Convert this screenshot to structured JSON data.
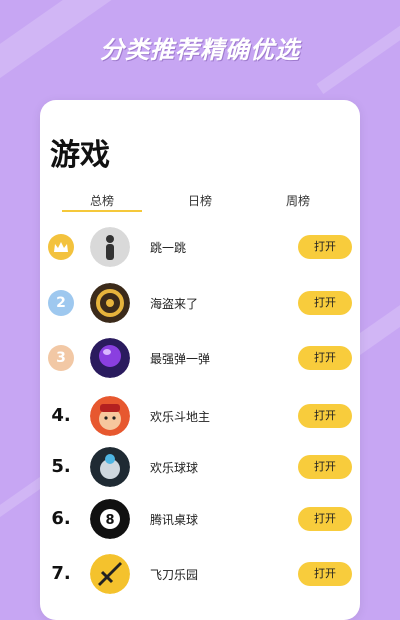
{
  "header": {
    "banner": "分类推荐精确优选"
  },
  "card": {
    "title": "游戏",
    "tabs": [
      {
        "label": "总榜",
        "active": true
      },
      {
        "label": "日榜",
        "active": false
      },
      {
        "label": "周榜",
        "active": false
      }
    ],
    "items": [
      {
        "rank": "1",
        "name": "跳一跳",
        "button": "打开"
      },
      {
        "rank": "2",
        "name": "海盗来了",
        "button": "打开"
      },
      {
        "rank": "3",
        "name": "最强弹一弹",
        "button": "打开"
      },
      {
        "rank": "4.",
        "name": "欢乐斗地主",
        "button": "打开"
      },
      {
        "rank": "5.",
        "name": "欢乐球球",
        "button": "打开"
      },
      {
        "rank": "6.",
        "name": "腾讯桌球",
        "button": "打开"
      },
      {
        "rank": "7.",
        "name": "飞刀乐园",
        "button": "打开"
      }
    ]
  },
  "colors": {
    "background": "#c7a6f3",
    "accent": "#f8cc3c",
    "gold": "#f3c23d",
    "silver": "#9ec8ef",
    "bronze": "#f2c8a5"
  }
}
